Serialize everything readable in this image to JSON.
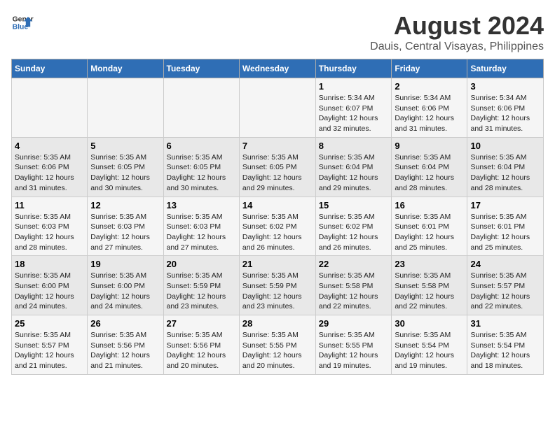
{
  "header": {
    "logo_line1": "General",
    "logo_line2": "Blue",
    "title": "August 2024",
    "subtitle": "Dauis, Central Visayas, Philippines"
  },
  "weekdays": [
    "Sunday",
    "Monday",
    "Tuesday",
    "Wednesday",
    "Thursday",
    "Friday",
    "Saturday"
  ],
  "weeks": [
    [
      {
        "day": "",
        "info": ""
      },
      {
        "day": "",
        "info": ""
      },
      {
        "day": "",
        "info": ""
      },
      {
        "day": "",
        "info": ""
      },
      {
        "day": "1",
        "info": "Sunrise: 5:34 AM\nSunset: 6:07 PM\nDaylight: 12 hours\nand 32 minutes."
      },
      {
        "day": "2",
        "info": "Sunrise: 5:34 AM\nSunset: 6:06 PM\nDaylight: 12 hours\nand 31 minutes."
      },
      {
        "day": "3",
        "info": "Sunrise: 5:34 AM\nSunset: 6:06 PM\nDaylight: 12 hours\nand 31 minutes."
      }
    ],
    [
      {
        "day": "4",
        "info": "Sunrise: 5:35 AM\nSunset: 6:06 PM\nDaylight: 12 hours\nand 31 minutes."
      },
      {
        "day": "5",
        "info": "Sunrise: 5:35 AM\nSunset: 6:05 PM\nDaylight: 12 hours\nand 30 minutes."
      },
      {
        "day": "6",
        "info": "Sunrise: 5:35 AM\nSunset: 6:05 PM\nDaylight: 12 hours\nand 30 minutes."
      },
      {
        "day": "7",
        "info": "Sunrise: 5:35 AM\nSunset: 6:05 PM\nDaylight: 12 hours\nand 29 minutes."
      },
      {
        "day": "8",
        "info": "Sunrise: 5:35 AM\nSunset: 6:04 PM\nDaylight: 12 hours\nand 29 minutes."
      },
      {
        "day": "9",
        "info": "Sunrise: 5:35 AM\nSunset: 6:04 PM\nDaylight: 12 hours\nand 28 minutes."
      },
      {
        "day": "10",
        "info": "Sunrise: 5:35 AM\nSunset: 6:04 PM\nDaylight: 12 hours\nand 28 minutes."
      }
    ],
    [
      {
        "day": "11",
        "info": "Sunrise: 5:35 AM\nSunset: 6:03 PM\nDaylight: 12 hours\nand 28 minutes."
      },
      {
        "day": "12",
        "info": "Sunrise: 5:35 AM\nSunset: 6:03 PM\nDaylight: 12 hours\nand 27 minutes."
      },
      {
        "day": "13",
        "info": "Sunrise: 5:35 AM\nSunset: 6:03 PM\nDaylight: 12 hours\nand 27 minutes."
      },
      {
        "day": "14",
        "info": "Sunrise: 5:35 AM\nSunset: 6:02 PM\nDaylight: 12 hours\nand 26 minutes."
      },
      {
        "day": "15",
        "info": "Sunrise: 5:35 AM\nSunset: 6:02 PM\nDaylight: 12 hours\nand 26 minutes."
      },
      {
        "day": "16",
        "info": "Sunrise: 5:35 AM\nSunset: 6:01 PM\nDaylight: 12 hours\nand 25 minutes."
      },
      {
        "day": "17",
        "info": "Sunrise: 5:35 AM\nSunset: 6:01 PM\nDaylight: 12 hours\nand 25 minutes."
      }
    ],
    [
      {
        "day": "18",
        "info": "Sunrise: 5:35 AM\nSunset: 6:00 PM\nDaylight: 12 hours\nand 24 minutes."
      },
      {
        "day": "19",
        "info": "Sunrise: 5:35 AM\nSunset: 6:00 PM\nDaylight: 12 hours\nand 24 minutes."
      },
      {
        "day": "20",
        "info": "Sunrise: 5:35 AM\nSunset: 5:59 PM\nDaylight: 12 hours\nand 23 minutes."
      },
      {
        "day": "21",
        "info": "Sunrise: 5:35 AM\nSunset: 5:59 PM\nDaylight: 12 hours\nand 23 minutes."
      },
      {
        "day": "22",
        "info": "Sunrise: 5:35 AM\nSunset: 5:58 PM\nDaylight: 12 hours\nand 22 minutes."
      },
      {
        "day": "23",
        "info": "Sunrise: 5:35 AM\nSunset: 5:58 PM\nDaylight: 12 hours\nand 22 minutes."
      },
      {
        "day": "24",
        "info": "Sunrise: 5:35 AM\nSunset: 5:57 PM\nDaylight: 12 hours\nand 22 minutes."
      }
    ],
    [
      {
        "day": "25",
        "info": "Sunrise: 5:35 AM\nSunset: 5:57 PM\nDaylight: 12 hours\nand 21 minutes."
      },
      {
        "day": "26",
        "info": "Sunrise: 5:35 AM\nSunset: 5:56 PM\nDaylight: 12 hours\nand 21 minutes."
      },
      {
        "day": "27",
        "info": "Sunrise: 5:35 AM\nSunset: 5:56 PM\nDaylight: 12 hours\nand 20 minutes."
      },
      {
        "day": "28",
        "info": "Sunrise: 5:35 AM\nSunset: 5:55 PM\nDaylight: 12 hours\nand 20 minutes."
      },
      {
        "day": "29",
        "info": "Sunrise: 5:35 AM\nSunset: 5:55 PM\nDaylight: 12 hours\nand 19 minutes."
      },
      {
        "day": "30",
        "info": "Sunrise: 5:35 AM\nSunset: 5:54 PM\nDaylight: 12 hours\nand 19 minutes."
      },
      {
        "day": "31",
        "info": "Sunrise: 5:35 AM\nSunset: 5:54 PM\nDaylight: 12 hours\nand 18 minutes."
      }
    ]
  ]
}
